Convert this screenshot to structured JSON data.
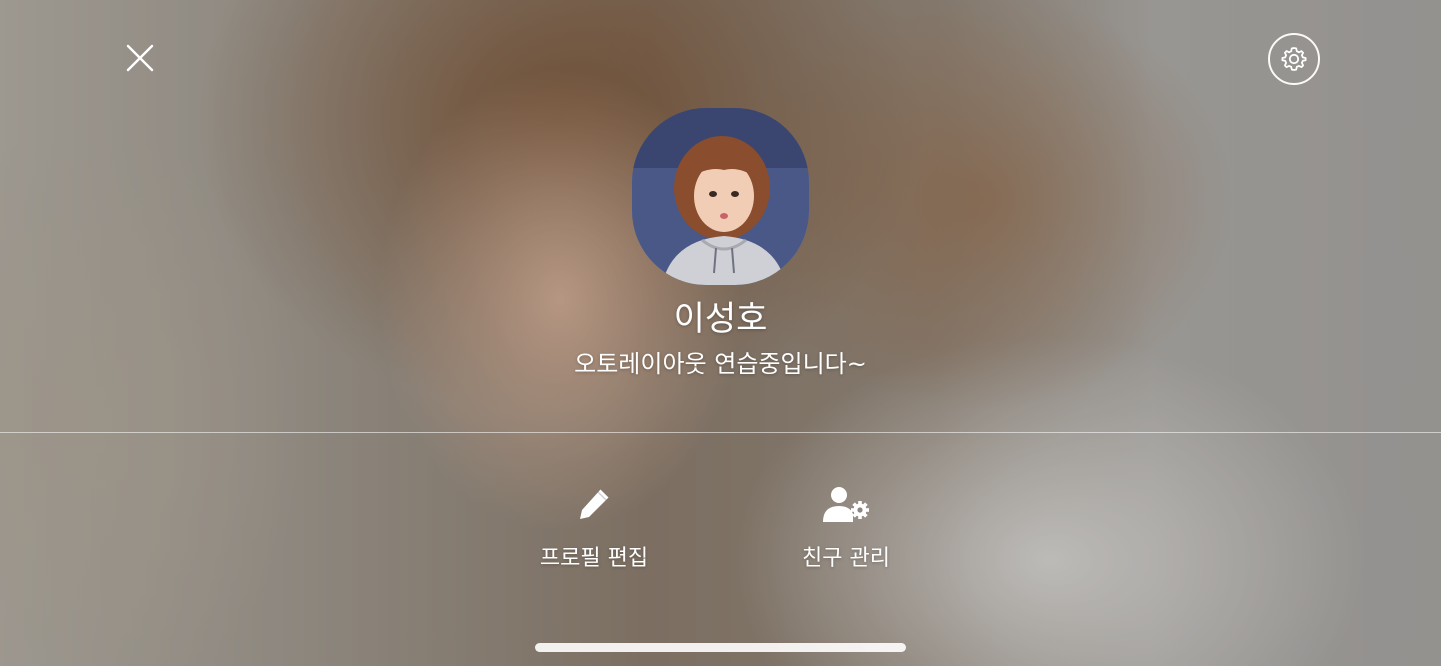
{
  "profile": {
    "name": "이성호",
    "status_message": "오토레이아웃 연습중입니다~"
  },
  "header": {
    "close_icon": "close-icon",
    "settings_icon": "gear-icon"
  },
  "actions": [
    {
      "label": "프로필 편집",
      "icon": "pencil-icon"
    },
    {
      "label": "친구 관리",
      "icon": "person-gear-icon"
    }
  ],
  "colors": {
    "text": "#ffffff",
    "divider": "#ffffff",
    "home_indicator": "#ffffff"
  }
}
